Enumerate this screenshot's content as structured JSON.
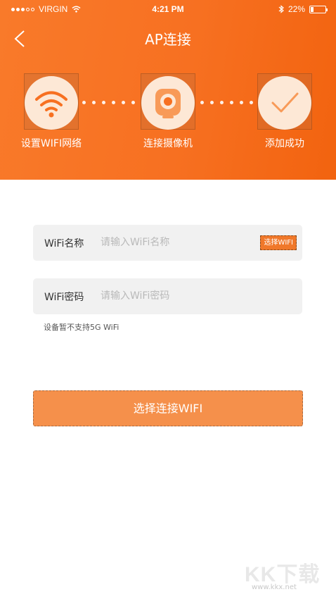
{
  "status_bar": {
    "carrier": "VIRGIN",
    "time": "4:21 PM",
    "battery": "22%",
    "battery_level": 0.22
  },
  "header": {
    "title": "AP连接",
    "background_color": "#f77021"
  },
  "steps": [
    {
      "label": "设置WIFI网络",
      "icon": "wifi-icon"
    },
    {
      "label": "连接摄像机",
      "icon": "camera-icon"
    },
    {
      "label": "添加成功",
      "icon": "checkmark-icon"
    }
  ],
  "form": {
    "wifi_name_label": "WiFi名称",
    "wifi_name_placeholder": "请输入WiFi名称",
    "select_wifi_small": "选择WIFI",
    "wifi_password_label": "WiFi密码",
    "wifi_password_placeholder": "请输入WiFi密码",
    "hint": "设备暂不支持5G WiFi"
  },
  "main_button": {
    "label": "选择连接WIFI"
  },
  "watermark": {
    "logo": "KK下载",
    "url": "www.kkx.net"
  },
  "colors": {
    "accent": "#f0782a",
    "button": "#f5904b",
    "field_bg": "#f1f1f1"
  }
}
